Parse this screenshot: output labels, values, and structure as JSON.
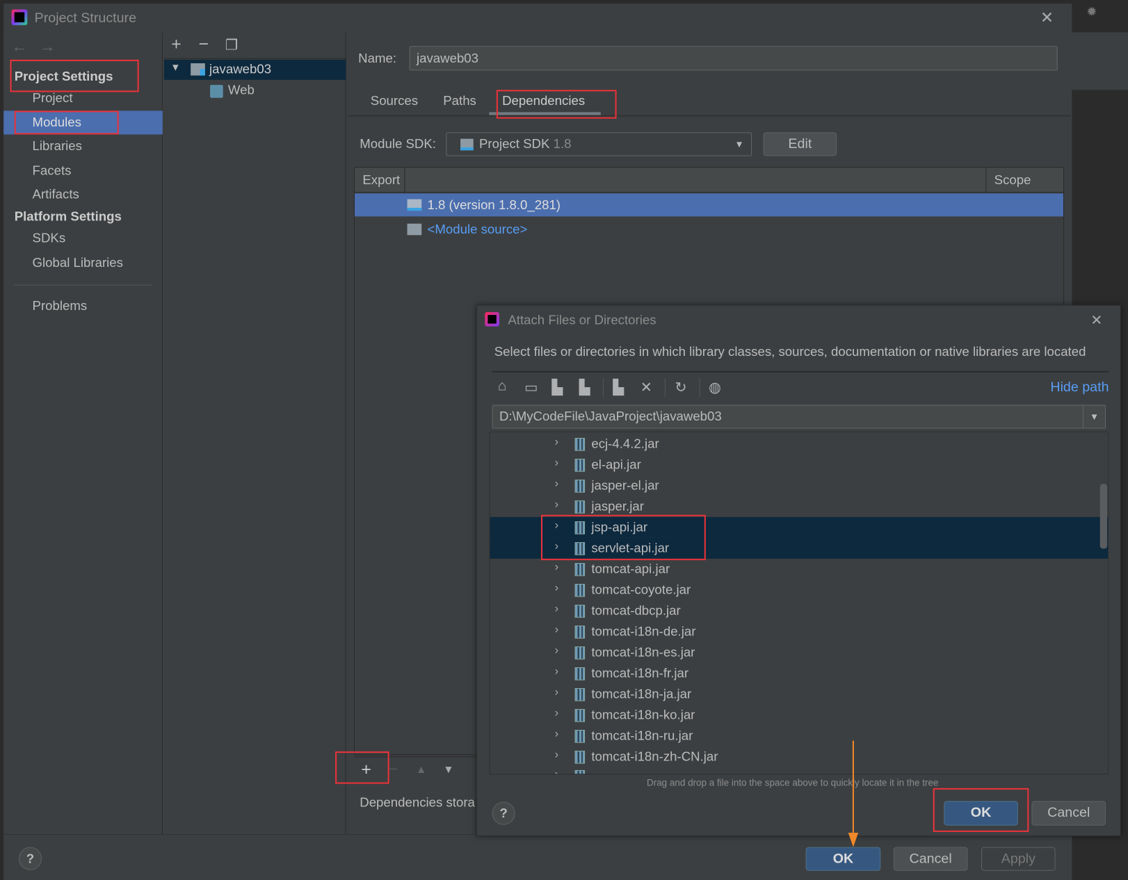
{
  "window": {
    "title": "Project Structure",
    "close_icon": "close-icon"
  },
  "sidebar": {
    "section1": "Project Settings",
    "items1": [
      {
        "label": "Project"
      },
      {
        "label": "Modules",
        "selected": true
      },
      {
        "label": "Libraries"
      },
      {
        "label": "Facets"
      },
      {
        "label": "Artifacts"
      }
    ],
    "section2": "Platform Settings",
    "items2": [
      {
        "label": "SDKs"
      },
      {
        "label": "Global Libraries"
      }
    ],
    "problems": "Problems"
  },
  "module_tree": {
    "root": "javaweb03",
    "child": "Web"
  },
  "module": {
    "name_label": "Name:",
    "name_value": "javaweb03",
    "tabs": [
      {
        "label": "Sources"
      },
      {
        "label": "Paths"
      },
      {
        "label": "Dependencies",
        "active": true
      }
    ],
    "sdk_label": "Module SDK:",
    "sdk_value": "Project SDK",
    "sdk_version": "1.8",
    "edit_label": "Edit",
    "table": {
      "col_export": "Export",
      "col_scope": "Scope",
      "rows": [
        {
          "label": "1.8 (version 1.8.0_281)",
          "selected": true
        },
        {
          "label": "<Module source>",
          "link": true
        }
      ]
    },
    "storage_label": "Dependencies stora"
  },
  "footer": {
    "ok": "OK",
    "cancel": "Cancel",
    "apply": "Apply",
    "help": "?"
  },
  "dialog": {
    "title": "Attach Files or Directories",
    "description": "Select files or directories in which library classes, sources, documentation or native libraries are located",
    "hide_path": "Hide path",
    "path": "D:\\MyCodeFile\\JavaProject\\javaweb03",
    "files": [
      {
        "name": "ecj-4.4.2.jar"
      },
      {
        "name": "el-api.jar"
      },
      {
        "name": "jasper-el.jar"
      },
      {
        "name": "jasper.jar"
      },
      {
        "name": "jsp-api.jar",
        "selected": true
      },
      {
        "name": "servlet-api.jar",
        "selected": true
      },
      {
        "name": "tomcat-api.jar"
      },
      {
        "name": "tomcat-coyote.jar"
      },
      {
        "name": "tomcat-dbcp.jar"
      },
      {
        "name": "tomcat-i18n-de.jar"
      },
      {
        "name": "tomcat-i18n-es.jar"
      },
      {
        "name": "tomcat-i18n-fr.jar"
      },
      {
        "name": "tomcat-i18n-ja.jar"
      },
      {
        "name": "tomcat-i18n-ko.jar"
      },
      {
        "name": "tomcat-i18n-ru.jar"
      },
      {
        "name": "tomcat-i18n-zh-CN.jar"
      }
    ],
    "hint": "Drag and drop a file into the space above to quickly locate it in the tree",
    "ok": "OK",
    "cancel": "Cancel",
    "help": "?"
  },
  "colors": {
    "selection": "#4b6eaf",
    "tree_selection": "#0d293e",
    "link": "#589df6",
    "highlight_box": "#e8333a",
    "arrow": "#f0882a"
  }
}
